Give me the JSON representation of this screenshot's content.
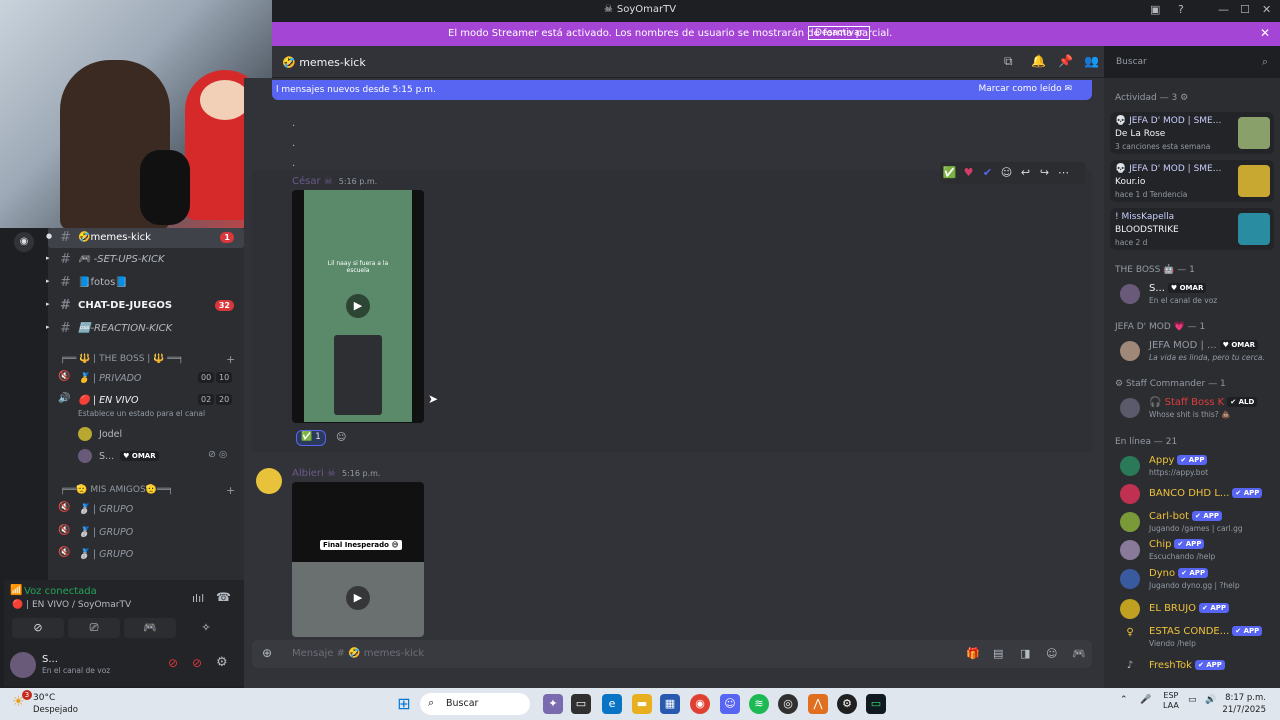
{
  "window": {
    "title": "SoyOmarTV"
  },
  "streamer_banner": {
    "text": "El modo Streamer está activado. Los nombres de usuario se mostrarán de forma parcial.",
    "button": "Desactivar"
  },
  "channel_header": {
    "name": "memes-kick",
    "emoji": "🤣"
  },
  "search": {
    "placeholder": "Buscar"
  },
  "new_messages": {
    "text": "l mensajes nuevos desde 5:15 p.m.",
    "action": "Marcar como leído"
  },
  "channels": [
    {
      "emoji": "🤣",
      "name": "memes-kick",
      "badge": "1",
      "active": true
    },
    {
      "emoji": "🎮",
      "name": "-SET-UPS-KICK",
      "badge": ""
    },
    {
      "emoji": "📘",
      "name": "fotos📘",
      "badge": ""
    },
    {
      "emoji": "",
      "name": "CHAT-DE-JUEGOS",
      "badge": "32"
    },
    {
      "emoji": "🆒",
      "name": "-REACTION-KICK",
      "badge": ""
    }
  ],
  "categories": {
    "boss": "╒══ 🔱 | THE BOSS | 🔱 ══╕",
    "amigos": "╒══🫡 MIS AMIGOS🫡══╕"
  },
  "voice_channels": {
    "privado": {
      "name": "| PRIVADO",
      "c1": "00",
      "c2": "10"
    },
    "en_vivo": {
      "name": "| EN VIVO",
      "c1": "02",
      "c2": "20",
      "status": "Establece un estado para el canal"
    },
    "member1": "Jodel",
    "member2": "S...",
    "member2_tag": "OMAR",
    "grupos": [
      "| GRUPO",
      "| GRUPO",
      "| GRUPO"
    ]
  },
  "voice_panel": {
    "title": "Voz conectada",
    "sub": "| EN VIVO / SoyOmarTV"
  },
  "user_panel": {
    "name": "S...",
    "status": "En el canal de voz"
  },
  "messages": [
    {
      "author": "César",
      "time": "5:16 p.m.",
      "video_text": "Lil naay si fuera a la escuela",
      "reaction_count": "1"
    },
    {
      "author": "Albieri",
      "time": "5:16 p.m.",
      "video_text": "Final Inesperado 😅"
    }
  ],
  "composer": {
    "placeholder": "Mensaje # 🤣 memes-kick"
  },
  "activity": {
    "header": "Actividad — 3",
    "items": [
      {
        "name": "💀 JEFA D' MOD | SME...",
        "game": "De La Rose",
        "sub": "3 canciones esta semana"
      },
      {
        "name": "💀 JEFA D' MOD | SME...",
        "game": "Kour.io",
        "sub": "hace 1 d   Tendencia"
      },
      {
        "name": "! MissKapella",
        "game": "BLOODSTRIKE",
        "sub": "hace 2 d"
      }
    ]
  },
  "member_groups": {
    "boss": "THE BOSS 🤖 — 1",
    "boss_member": {
      "name": "S...",
      "tag": "OMAR",
      "status": "En el canal de voz"
    },
    "jefa": "JEFA D' MOD 💗 — 1",
    "jefa_member": {
      "name": "JEFA MOD | ...",
      "tag": "OMAR",
      "status": "La vida es linda, pero tu cerca."
    },
    "staff": "⚙ Staff Commander — 1",
    "staff_member": {
      "name": "Staff Boss K",
      "tag": "ALD",
      "status": "Whose shit is this? 💩"
    },
    "online": "En línea — 21"
  },
  "online_members": [
    {
      "name": "Appy",
      "tag": "APP",
      "status": "https://appy.bot"
    },
    {
      "name": "BANCO DHD L...",
      "tag": "APP",
      "status": ""
    },
    {
      "name": "Carl-bot",
      "tag": "APP",
      "status": "Jugando /games | carl.gg"
    },
    {
      "name": "Chip",
      "tag": "APP",
      "status": "Escuchando /help"
    },
    {
      "name": "Dyno",
      "tag": "APP",
      "status": "Jugando dyno.gg | ?help"
    },
    {
      "name": "EL BRUJO",
      "tag": "APP",
      "status": ""
    },
    {
      "name": "ESTAS CONDE...",
      "tag": "APP",
      "status": "Viendo /help"
    },
    {
      "name": "FreshTok",
      "tag": "APP",
      "status": ""
    }
  ],
  "taskbar": {
    "weather_temp": "30°C",
    "weather_desc": "Despejado",
    "search": "Buscar",
    "lang1": "ESP",
    "lang2": "LAA",
    "time": "8:17 p.m.",
    "date": "21/7/2025",
    "notif": "3"
  },
  "colors": {
    "accent": "#5865f2",
    "streamer_banner": "#a545d6",
    "online": "#23a559"
  }
}
